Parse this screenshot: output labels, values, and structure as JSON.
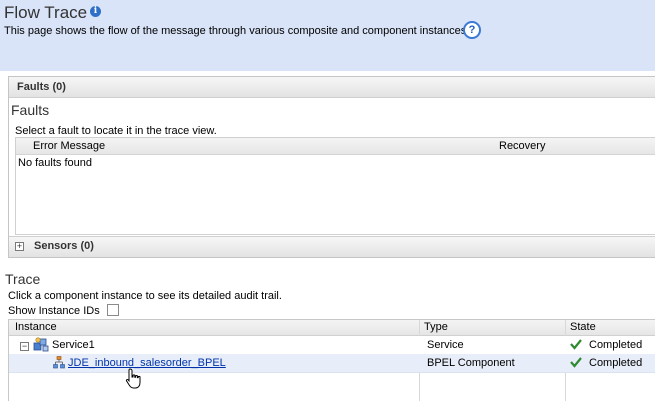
{
  "header": {
    "title": "Flow Trace",
    "description": "This page shows the flow of the message through various composite and component instances."
  },
  "faults_panel": {
    "bar_label": "Faults (0)",
    "heading": "Faults",
    "instruction": "Select a fault to locate it in the trace view.",
    "columns": [
      "Error Message",
      "Recovery"
    ],
    "empty_text": "No faults found"
  },
  "sensors_panel": {
    "bar_label": "Sensors (0)"
  },
  "trace": {
    "heading": "Trace",
    "instruction": "Click a component instance to see its detailed audit trail.",
    "show_ids_label": "Show Instance IDs",
    "show_ids_checked": false,
    "columns": [
      "Instance",
      "Type",
      "State"
    ],
    "rows": [
      {
        "instance": "Service1",
        "type": "Service",
        "state": "Completed",
        "icon": "service-icon"
      },
      {
        "instance": "JDE_inbound_salesorder_BPEL",
        "type": "BPEL Component",
        "state": "Completed",
        "icon": "bpel-component-icon"
      }
    ]
  },
  "colors": {
    "header_bg": "#d9e4f8",
    "link": "#0033aa",
    "selected_row": "#e8eef9",
    "completed_check": "#2f8a2f"
  }
}
